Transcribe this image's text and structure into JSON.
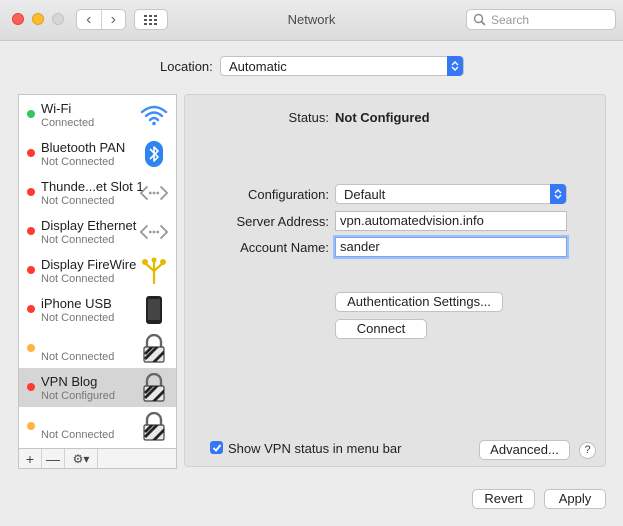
{
  "window": {
    "title": "Network"
  },
  "toolbar": {
    "back": "‹",
    "forward": "›",
    "search_placeholder": "Search"
  },
  "location": {
    "label": "Location:",
    "value": "Automatic"
  },
  "services": [
    {
      "name": "Wi-Fi",
      "status": "Connected",
      "dot": "#34c759",
      "icon": "wifi-icon"
    },
    {
      "name": "Bluetooth PAN",
      "status": "Not Connected",
      "dot": "#ff3b30",
      "icon": "bluetooth-icon"
    },
    {
      "name": "Thunde...et Slot 1",
      "status": "Not Connected",
      "dot": "#ff3b30",
      "icon": "ethernet-icon"
    },
    {
      "name": "Display Ethernet",
      "status": "Not Connected",
      "dot": "#ff3b30",
      "icon": "ethernet-icon"
    },
    {
      "name": "Display FireWire",
      "status": "Not Connected",
      "dot": "#ff3b30",
      "icon": "firewire-icon"
    },
    {
      "name": "iPhone USB",
      "status": "Not Connected",
      "dot": "#ff3b30",
      "icon": "iphone-icon"
    },
    {
      "name": "",
      "status": "Not Connected",
      "dot": "#ffb340",
      "icon": "vpn-lock-icon"
    },
    {
      "name": "VPN Blog",
      "status": "Not Configured",
      "dot": "#ff3b30",
      "icon": "vpn-lock-icon",
      "selected": true
    },
    {
      "name": "",
      "status": "Not Connected",
      "dot": "#ffb340",
      "icon": "vpn-lock-icon"
    }
  ],
  "sidebar_footer": {
    "add": "+",
    "remove": "—",
    "gear": "⚙︎▾"
  },
  "detail": {
    "status_label": "Status:",
    "status_value": "Not Configured",
    "configuration_label": "Configuration:",
    "configuration_value": "Default",
    "server_label": "Server Address:",
    "server_value": "vpn.automatedvision.info",
    "account_label": "Account Name:",
    "account_value": "sander",
    "auth_button": "Authentication Settings...",
    "connect_button": "Connect",
    "show_status_label": "Show VPN status in menu bar",
    "show_status_checked": true,
    "advanced_button": "Advanced...",
    "help": "?"
  },
  "footer": {
    "revert": "Revert",
    "apply": "Apply"
  }
}
